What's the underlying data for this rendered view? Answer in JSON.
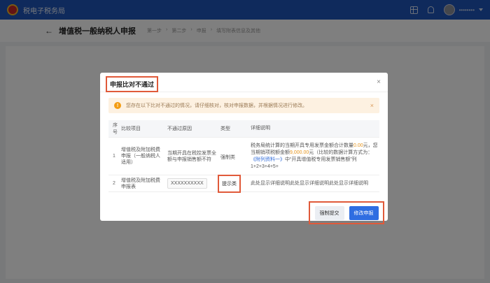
{
  "header": {
    "brand": "税电子税务局",
    "username": "••••••••"
  },
  "page": {
    "back_icon": "←",
    "title": "增值税一般纳税人申报",
    "breadcrumbs": [
      "第一步",
      "第二步",
      "申报",
      "填写附表信息及其他"
    ]
  },
  "modal": {
    "title": "申报比对不通过",
    "close_icon": "×",
    "alert": {
      "text": "您存在以下比对不通过的情况，请仔细核对，核对申报数据，并根据情况进行修改。",
      "close": "×"
    },
    "table": {
      "headers": [
        "序号",
        "比较项目",
        "不通过原因",
        "类型",
        "详细说明"
      ],
      "rows": [
        {
          "index": "1",
          "item": "增值税及附加税费申报（一般纳税人适用）",
          "reason": "当期开具在税控发票全额与申报销售额不符",
          "type": "强制类",
          "detail_prefix": "税务局统计算的当期开具专用发票金额合计数量",
          "detail_amount1": "0.00",
          "detail_mid1": "元，您当期销项税额金额",
          "detail_amount2": "9,000.00",
          "detail_mid2": "元（比较的数据计算方式为：",
          "detail_link": "《附列资料一》",
          "detail_suffix": "中“开具增值税专用发票销售额”列 1+2+3+4+5+"
        },
        {
          "index": "2",
          "item": "增值税及附加税费申报表",
          "reason": "XXXXXXXXXX",
          "type": "提示类",
          "detail": "此处显示详细说明此处显示详细说明此处显示详细说明"
        }
      ]
    },
    "buttons": {
      "force_submit": "强制提交",
      "modify_declaration": "修改申报"
    }
  },
  "colors": {
    "topbar": "#1f55b8",
    "highlight_box": "#e05a3a",
    "primary_button": "#2f6de1",
    "alert_bg": "#fdf1e1"
  }
}
